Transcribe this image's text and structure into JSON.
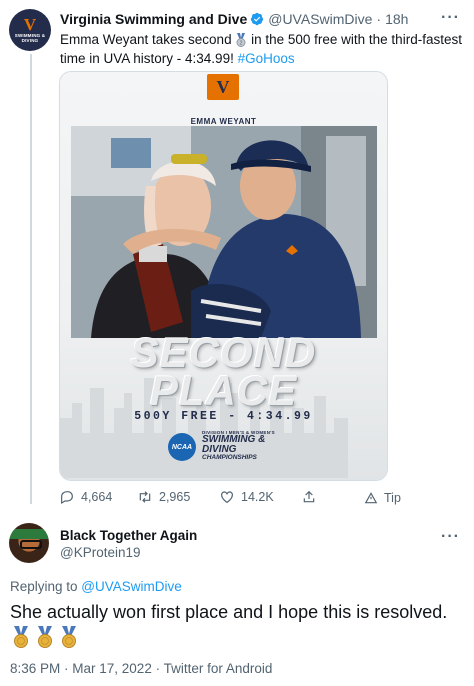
{
  "tweet": {
    "author_name": "Virginia Swimming and Dive",
    "author_handle": "@UVASwimDive",
    "time_ago": "18h",
    "text_part1": "Emma Weyant takes second ",
    "text_part2": " in the 500 free with the third-fastest time in UVA history - 4:34.99! ",
    "hashtag": "#GoHoos",
    "avatar": {
      "letter": "V",
      "caption": "SWIMMING & DIVING"
    },
    "media": {
      "badge": "V",
      "athlete": "EMMA WEYANT",
      "headline": "SECOND PLACE",
      "event_line": "500Y FREE  -  4:34.99",
      "ncaa": "NCAA",
      "champ_line1": "DIVISION I MEN'S & WOMEN'S",
      "champ_line2": "SWIMMING & DIVING",
      "champ_line3": "CHAMPIONSHIPS"
    },
    "stats": {
      "replies": "4,664",
      "retweets": "2,965",
      "likes": "14.2K",
      "tip": "Tip"
    }
  },
  "reply": {
    "author_name": "Black Together Again",
    "author_handle": "@KProtein19",
    "replying_prefix": "Replying to ",
    "replying_to": "@UVASwimDive",
    "text": "She actually won first place and I hope this is resolved.",
    "meta": "8:36 PM · Mar 17, 2022 · Twitter for Android"
  },
  "colors": {
    "accent": "#1d9bf0",
    "uva_navy": "#232d4b",
    "uva_orange": "#e57200",
    "muted": "#536471",
    "gold": "#e8b33a"
  },
  "icons": [
    "verified-badge-icon",
    "second-place-medal-icon",
    "reply-icon",
    "retweet-icon",
    "like-icon",
    "share-icon",
    "tip-icon",
    "more-icon",
    "gold-medal-icon"
  ]
}
